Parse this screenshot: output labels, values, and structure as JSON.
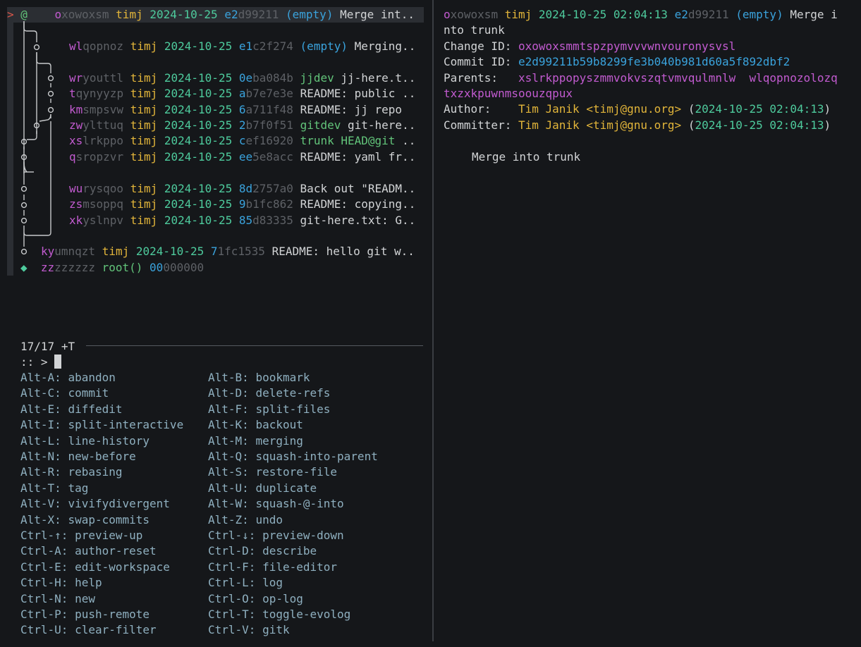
{
  "log": {
    "selected": {
      "marker": ">",
      "symbol": "@",
      "id_prefix": "o",
      "id_rest": "xowoxsm",
      "author": "timj",
      "date": "2024-10-25",
      "hash_prefix": "e2",
      "hash_rest": "d99211",
      "tag": "(empty)",
      "desc": "Merge int.."
    },
    "rows": [
      {
        "id_prefix": "wl",
        "id_rest": "qopnoz",
        "author": "timj",
        "date": "2024-10-25",
        "hash_prefix": "e1",
        "hash_rest": "c2f274",
        "tag": "(empty)",
        "desc": "Merging.."
      },
      {
        "id_prefix": "wr",
        "id_rest": "youttl",
        "author": "timj",
        "date": "2024-10-25",
        "hash_prefix": "0e",
        "hash_rest": "ba084b",
        "tag": "jjdev",
        "desc": "jj-here.t.."
      },
      {
        "id_prefix": "t",
        "id_rest": "qynyyzp",
        "author": "timj",
        "date": "2024-10-25",
        "hash_prefix": "a",
        "hash_rest": "b7e7e3e",
        "tag": "",
        "desc": "README: public .."
      },
      {
        "id_prefix": "km",
        "id_rest": "smpsvw",
        "author": "timj",
        "date": "2024-10-25",
        "hash_prefix": "6",
        "hash_rest": "a711f48",
        "tag": "",
        "desc": "README: jj repo"
      },
      {
        "id_prefix": "zw",
        "id_rest": "ylttuq",
        "author": "timj",
        "date": "2024-10-25",
        "hash_prefix": "2",
        "hash_rest": "b7f0f51",
        "tag": "gitdev",
        "desc": "git-here.."
      },
      {
        "id_prefix": "xs",
        "id_rest": "lrkppo",
        "author": "timj",
        "date": "2024-10-25",
        "hash_prefix": "c",
        "hash_rest": "ef16920",
        "tag": "trunk HEAD@git",
        "desc": ".."
      },
      {
        "id_prefix": "q",
        "id_rest": "sropzvr",
        "author": "timj",
        "date": "2024-10-25",
        "hash_prefix": "ee",
        "hash_rest": "5e8acc",
        "tag": "",
        "desc": "README: yaml fr.."
      },
      {
        "id_prefix": "wu",
        "id_rest": "rysqoo",
        "author": "timj",
        "date": "2024-10-25",
        "hash_prefix": "8d",
        "hash_rest": "2757a0",
        "tag": "",
        "desc": "Back out \"READM.."
      },
      {
        "id_prefix": "zs",
        "id_rest": "msoppq",
        "author": "timj",
        "date": "2024-10-25",
        "hash_prefix": "9",
        "hash_rest": "b1fc862",
        "tag": "",
        "desc": "README: copying.."
      },
      {
        "id_prefix": "xk",
        "id_rest": "yslnpv",
        "author": "timj",
        "date": "2024-10-25",
        "hash_prefix": "85",
        "hash_rest": "d83335",
        "tag": "",
        "desc": "git-here.txt: G.."
      },
      {
        "id_prefix": "ky",
        "id_rest": "umnqzt",
        "author": "timj",
        "date": "2024-10-25",
        "hash_prefix": "7",
        "hash_rest": "1fc1535",
        "tag": "",
        "desc": "README: hello git w.."
      }
    ],
    "root": {
      "symbol": "◆",
      "id_prefix": "zz",
      "id_rest": "zzzzzz",
      "label": "root()",
      "hash_prefix": "00",
      "hash_rest": "000000"
    }
  },
  "filter": {
    "count": "17/17",
    "mode": "+T",
    "prompt": ":: >"
  },
  "keybindings": [
    [
      "Alt-A:",
      "abandon",
      "Alt-B:",
      "bookmark"
    ],
    [
      "Alt-C:",
      "commit",
      "Alt-D:",
      "delete-refs"
    ],
    [
      "Alt-E:",
      "diffedit",
      "Alt-F:",
      "split-files"
    ],
    [
      "Alt-I:",
      "split-interactive",
      "Alt-K:",
      "backout"
    ],
    [
      "Alt-L:",
      "line-history",
      "Alt-M:",
      "merging"
    ],
    [
      "Alt-N:",
      "new-before",
      "Alt-Q:",
      "squash-into-parent"
    ],
    [
      "Alt-R:",
      "rebasing",
      "Alt-S:",
      "restore-file"
    ],
    [
      "Alt-T:",
      "tag",
      "Alt-U:",
      "duplicate"
    ],
    [
      "Alt-V:",
      "vivifydivergent",
      "Alt-W:",
      "squash-@-into"
    ],
    [
      "Alt-X:",
      "swap-commits",
      "Alt-Z:",
      "undo"
    ],
    [
      "Ctrl-↑:",
      "preview-up",
      "Ctrl-↓:",
      "preview-down"
    ],
    [
      "Ctrl-A:",
      "author-reset",
      "Ctrl-D:",
      "describe"
    ],
    [
      "Ctrl-E:",
      "edit-workspace",
      "Ctrl-F:",
      "file-editor"
    ],
    [
      "Ctrl-H:",
      "help",
      "Ctrl-L:",
      "log"
    ],
    [
      "Ctrl-N:",
      "new",
      "Ctrl-O:",
      "op-log"
    ],
    [
      "Ctrl-P:",
      "push-remote",
      "Ctrl-T:",
      "toggle-evolog"
    ],
    [
      "Ctrl-U:",
      "clear-filter",
      "Ctrl-V:",
      "gitk"
    ]
  ],
  "preview": {
    "header": {
      "id_prefix": "o",
      "id_rest": "xowoxsm",
      "author": "timj",
      "datetime": "2024-10-25 02:04:13",
      "hash_prefix": "e2",
      "hash_rest": "d99211",
      "tag": "(empty)",
      "desc_line1": "Merge i",
      "desc_line2": "nto trunk"
    },
    "change_id_label": "Change ID:",
    "change_id": "oxowoxsmmtspzpymvvvwnvouronysvsl",
    "commit_id_label": "Commit ID:",
    "commit_id": "e2d99211b59b8299fe3b040b981d60a5f892dbf2",
    "parents_label": "Parents:",
    "parent1": "xslrkppopyszmmvokvszqtvmvqulmnlw",
    "parent2": "wlqopnozolozq",
    "parent2_cont": "txzxkpuwnmsoouzqpux",
    "author_label": "Author:",
    "committer_label": "Committer:",
    "person_name": "Tim Janik",
    "person_email": "<timj@gnu.org>",
    "person_date": "2024-10-25 02:04:13",
    "message": "Merge into trunk"
  },
  "colors": {
    "background": "#15171a",
    "change_id": "#c25bd0",
    "commit_hash": "#3aa3dd",
    "author": "#e2b53a",
    "date": "#4ecb9d",
    "bookmark": "#62c47a"
  }
}
